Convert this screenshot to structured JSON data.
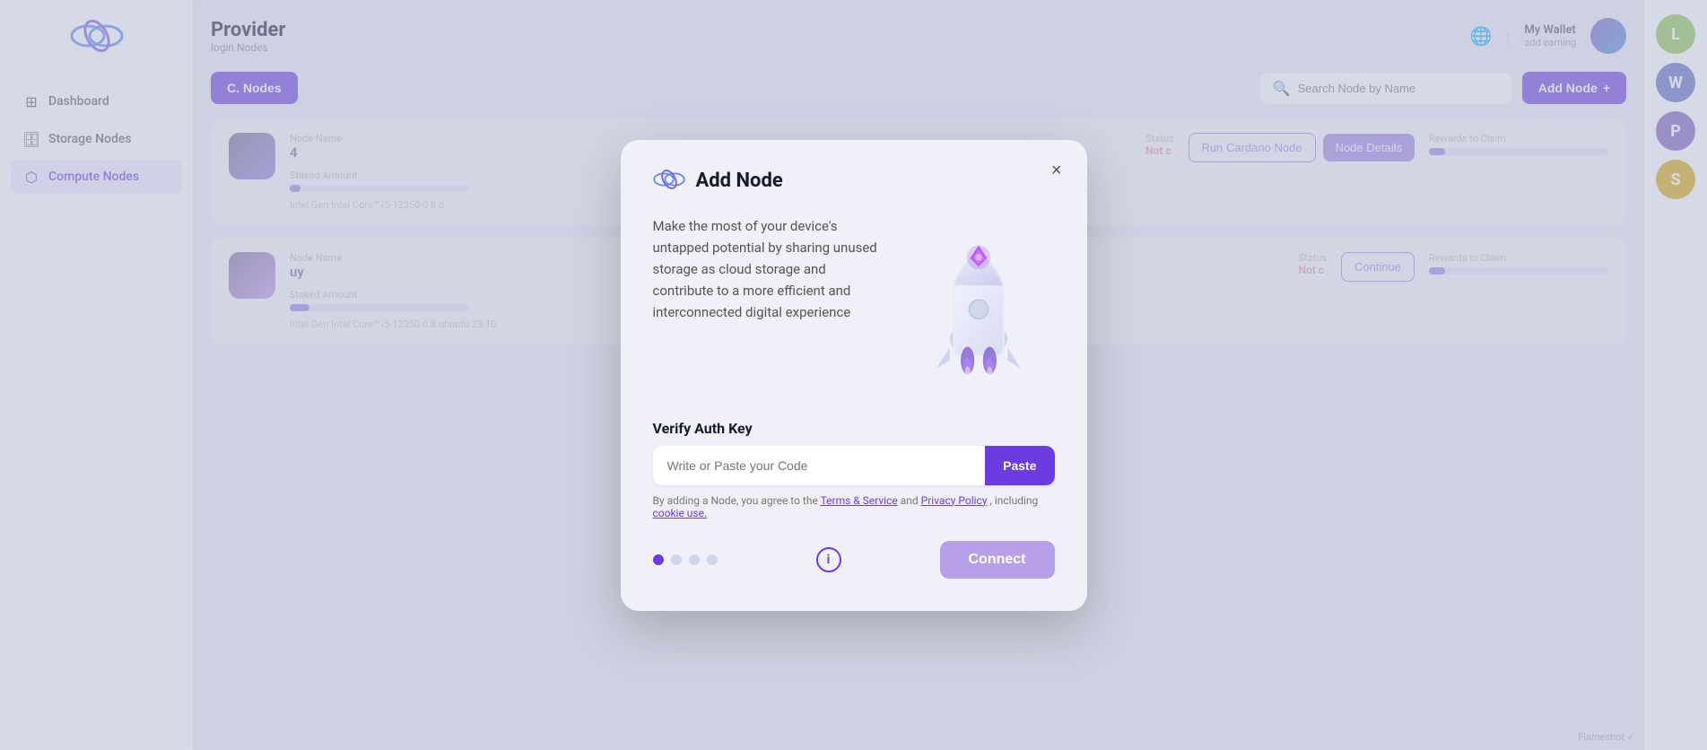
{
  "sidebar": {
    "logo_alt": "Provider Logo",
    "items": [
      {
        "id": "dashboard",
        "label": "Dashboard",
        "icon": "grid",
        "active": false
      },
      {
        "id": "storage-nodes",
        "label": "Storage Nodes",
        "icon": "database",
        "active": false
      },
      {
        "id": "compute-nodes",
        "label": "Compute Nodes",
        "icon": "cpu",
        "active": true
      }
    ]
  },
  "header": {
    "title": "Provider",
    "subtitle": "login Nodes",
    "wallet_label": "My Wallet",
    "wallet_sub": "add earning"
  },
  "toolbar": {
    "nodes_button": "C. Nodes",
    "search_placeholder": "Search Node by Name",
    "add_node_button": "Add Node",
    "add_node_icon": "+"
  },
  "nodes": [
    {
      "id": "node-1",
      "name_label": "Node Name",
      "name_value": "4",
      "status_label": "Status",
      "status_value": "Not c",
      "staked_label": "Staked Amount",
      "rewards_label": "Rewards to Claim",
      "intel": "Intel Gen Intel Core™ i5-12350  0.8 c",
      "btn_cardano": "Run Cardano Node",
      "btn_details": "Node Details"
    },
    {
      "id": "node-2",
      "name_label": "Node Name",
      "name_value": "uy",
      "status_label": "Status",
      "status_value": "Not c",
      "staked_label": "Staked Amount",
      "rewards_label": "Rewards to Claim",
      "intel": "Intel Gen Intel Core™ i5-12350  0.8 ubuntu 23.10",
      "btn_continue": "Continue"
    }
  ],
  "right_panel": {
    "avatars": [
      {
        "id": "rp-l",
        "label": "L",
        "color": "#8bc34a"
      },
      {
        "id": "rp-w",
        "label": "W",
        "color": "#5c6bc0"
      },
      {
        "id": "rp-p",
        "label": "P",
        "color": "#7c5cbf"
      },
      {
        "id": "rp-s",
        "label": "S",
        "color": "#e0c040"
      }
    ]
  },
  "modal": {
    "title": "Add Node",
    "close_icon": "×",
    "description": "Make the most of your device's untapped potential by sharing unused storage as cloud storage and contribute to a more efficient and interconnected digital experience",
    "verify_label": "Verify Auth Key",
    "input_placeholder": "Write or Paste your Code",
    "paste_button": "Paste",
    "terms_text": "By adding a Node, you agree to the",
    "terms_link1": "Terms & Service",
    "terms_and": "and",
    "terms_link2": "Privacy Policy",
    "terms_including": ", including",
    "terms_link3": "cookie use.",
    "connect_button": "Connect",
    "info_icon": "i",
    "dots": [
      {
        "active": true
      },
      {
        "active": false
      },
      {
        "active": false
      },
      {
        "active": false
      }
    ]
  },
  "watermark": "Flameshot ✓"
}
